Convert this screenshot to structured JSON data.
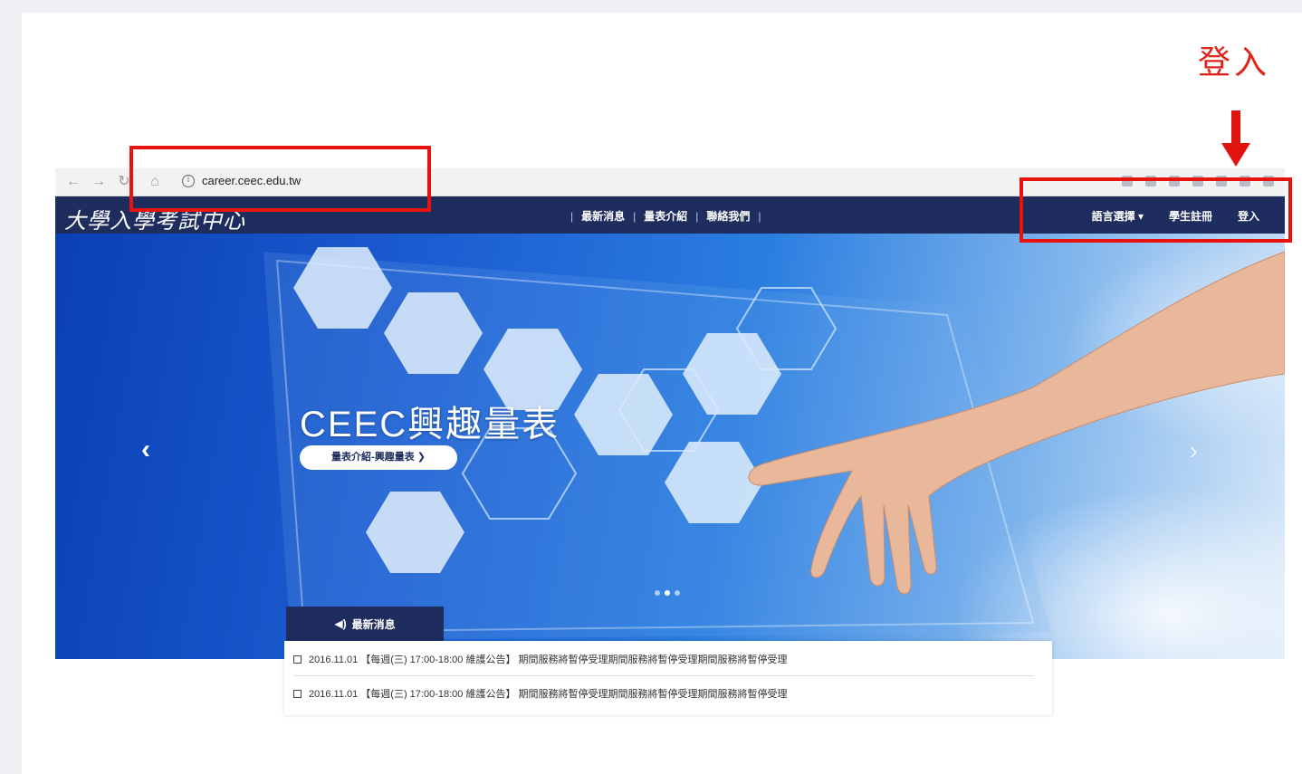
{
  "annotation": {
    "label": "登入",
    "color": "#e8130f"
  },
  "browser": {
    "url": "career.ceec.edu.tw",
    "nav_icons": [
      "back-icon",
      "forward-icon",
      "reload-icon",
      "home-icon"
    ]
  },
  "site": {
    "logo_text": "大學入學考試中心",
    "menu": [
      "最新消息",
      "量表介紹",
      "聯絡我們"
    ],
    "right_nav": [
      "語言選擇 ▾",
      "學生註冊",
      "登入"
    ],
    "nav_color": "#1e2d5e"
  },
  "hero": {
    "title": "CEEC興趣量表",
    "button_label": "量表介紹-興趣量表 ❯",
    "prev_icon": "chevron-left-icon",
    "next_icon": "chevron-right-icon",
    "slides_total": 3,
    "slide_active": 2
  },
  "news": {
    "tab_label": "最新消息",
    "items": [
      "2016.11.01 【每週(三) 17:00-18:00 維護公告】 期間服務將暫停受理期間服務將暫停受理期間服務將暫停受理",
      "2016.11.01 【每週(三) 17:00-18:00 維護公告】 期間服務將暫停受理期間服務將暫停受理期間服務將暫停受理"
    ]
  }
}
